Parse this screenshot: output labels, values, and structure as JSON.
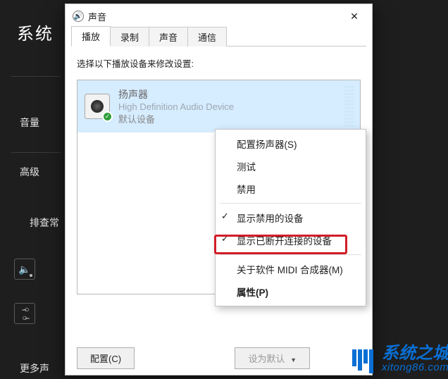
{
  "background": {
    "title": "系统",
    "volume_label": "音量",
    "advanced_label": "高级",
    "troubleshoot_label": "排查常",
    "more_sound_label": "更多声"
  },
  "dialog": {
    "title": "声音",
    "tabs": {
      "playback": "播放",
      "recording": "录制",
      "sounds": "声音",
      "communications": "通信"
    },
    "hint": "选择以下播放设备来修改设置:",
    "device": {
      "name": "扬声器",
      "desc": "High Definition Audio Device",
      "status": "默认设备"
    },
    "configure_btn": "配置(C)",
    "set_default_btn": "设为默认"
  },
  "context_menu": {
    "configure_speakers": "配置扬声器(S)",
    "test": "测试",
    "disable": "禁用",
    "show_disabled": "显示禁用的设备",
    "show_disconnected": "显示已断开连接的设备",
    "about_midi": "关于软件 MIDI 合成器(M)",
    "properties": "属性(P)"
  },
  "watermark": {
    "brand": "系统之城",
    "site": "xitong86.com"
  }
}
